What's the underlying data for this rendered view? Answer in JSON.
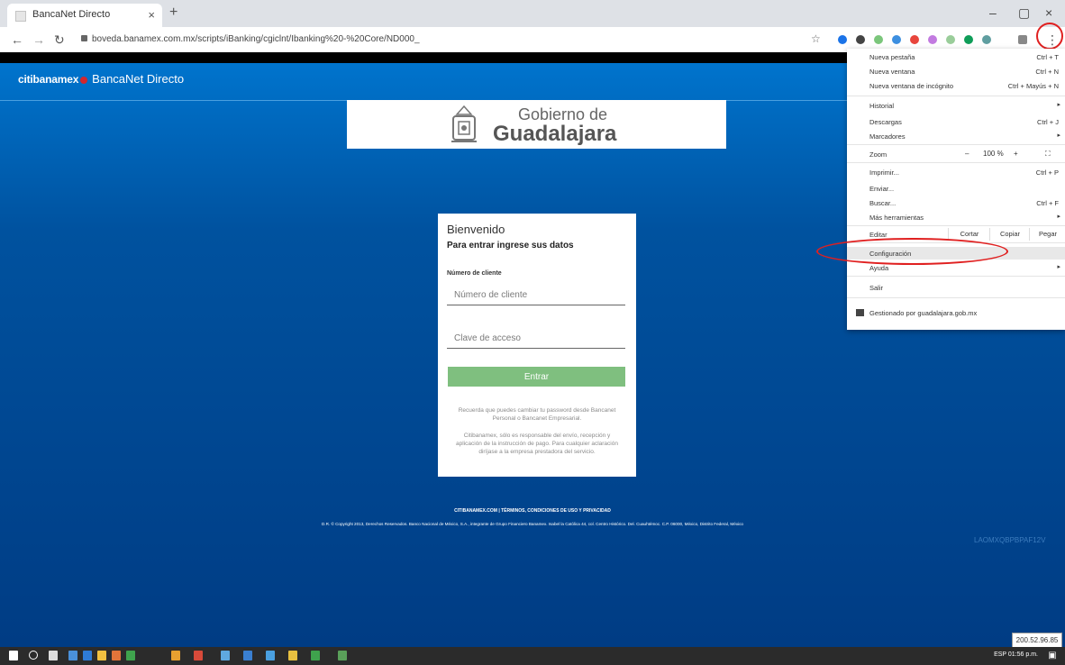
{
  "browser": {
    "tab_title": "BancaNet Directo",
    "tab_close": "×",
    "new_tab": "+",
    "url": "boveda.banamex.com.mx/scripts/iBanking/cgiclnt/Ibanking%20-%20Core/ND000_",
    "window_min": "–",
    "window_restore": "▢",
    "window_close": "×",
    "menu_dots": "⋮"
  },
  "page": {
    "brand_citi": "citibanamex",
    "brand_product": "BancaNet Directo",
    "logo_line1": "Gobierno de",
    "logo_line2": "Guadalajara",
    "login": {
      "title": "Bienvenido",
      "subtitle": "Para entrar ingrese sus datos",
      "client_label": "Número de cliente",
      "client_placeholder": "Número de cliente",
      "password_placeholder": "Clave de acceso",
      "submit": "Entrar",
      "note1": "Recuerda que puedes cambiar tu password desde Bancanet Personal o Bancanet Empresarial.",
      "note2": "Citibanamex, sólo es responsable del envío, recepción y aplicación de la instrucción de pago. Para cualquier aclaración diríjase a la empresa prestadora del servicio."
    },
    "footer_links": "CITIBANAMEX.COM | TÉRMINOS, CONDICIONES DE USO Y PRIVACIDAD",
    "footer_copy": "D.R. © Copyright 2013, Derechos Reservados. Banco Nacional de México, S.A., integrante de Grupo Financiero Banamex. Isabel la Católica 44, col. Centro Histórico. Del. Cuauhtémoc. C.P. 06000, México, Distrito Federal, México",
    "page_code": "LAOMXQBPBPAF12V",
    "ip": "200.52.96.85"
  },
  "menu": {
    "new_tab": "Nueva pestaña",
    "new_tab_sc": "Ctrl + T",
    "new_window": "Nueva ventana",
    "new_window_sc": "Ctrl + N",
    "incognito": "Nueva ventana de incógnito",
    "incognito_sc": "Ctrl + Mayús + N",
    "history": "Historial",
    "downloads": "Descargas",
    "downloads_sc": "Ctrl + J",
    "bookmarks": "Marcadores",
    "zoom": "Zoom",
    "zoom_minus": "–",
    "zoom_value": "100 %",
    "zoom_plus": "+",
    "fullscreen": "⛶",
    "print": "Imprimir...",
    "print_sc": "Ctrl + P",
    "cast": "Enviar...",
    "find": "Buscar...",
    "find_sc": "Ctrl + F",
    "more_tools": "Más herramientas",
    "edit": "Editar",
    "cut": "Cortar",
    "copy": "Copiar",
    "paste": "Pegar",
    "settings": "Configuración",
    "help": "Ayuda",
    "exit": "Salir",
    "managed": "Gestionado por guadalajara.gob.mx",
    "arrow": "▸"
  },
  "taskbar": {
    "tray": "ESP  01:56 p.m."
  },
  "colors": {
    "annotation_red": "#e02020",
    "enter_button": "#7fbf7f",
    "page_blue": "#00529f"
  }
}
